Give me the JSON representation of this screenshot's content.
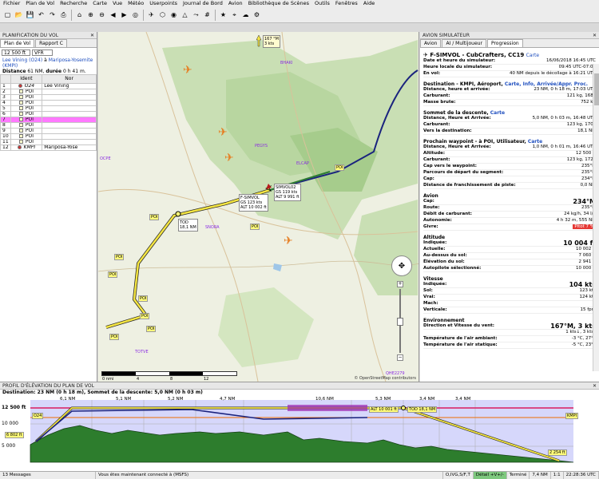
{
  "menu": [
    "Fichier",
    "Plan de Vol",
    "Recherche",
    "Carte",
    "Vue",
    "Météo",
    "Userpoints",
    "Journal de Bord",
    "Avion",
    "Bibliothèque de Scènes",
    "Outils",
    "Fenêtres",
    "Aide"
  ],
  "toolbar_icons": [
    "new-icon",
    "open-icon",
    "save-icon",
    "undo-icon",
    "redo-icon",
    "print-icon",
    "home-icon",
    "zoom-in-icon",
    "zoom-out-icon",
    "back-icon",
    "forward-icon",
    "center-icon",
    "airport-icon",
    "vor-icon",
    "ndb-icon",
    "waypoint-icon",
    "airway-icon",
    "grid-icon",
    "star-icon",
    "target-icon",
    "weather-icon",
    "settings-icon"
  ],
  "left_panel": {
    "title": "PLANIFICATION DU VOL",
    "tabs": [
      "Plan de Vol",
      "Rapport C"
    ],
    "altitude": "12 500 ft",
    "rule": "VFR",
    "route_from": "Lee Vining (O24)",
    "route_mid": " à ",
    "route_to": "Mariposa-Yosemite (KMPI)",
    "distance_label": "Distance",
    "distance_value": "61 NM,",
    "duration_label": "durée",
    "duration_value": "0 h 41 m.",
    "columns": [
      "Ident",
      "Nor"
    ],
    "rows": [
      {
        "n": "1",
        "ident": "O24",
        "name": "Lee Vining",
        "italic": true
      },
      {
        "n": "2",
        "ident": "POI",
        "name": ""
      },
      {
        "n": "3",
        "ident": "POI",
        "name": ""
      },
      {
        "n": "4",
        "ident": "POI",
        "name": ""
      },
      {
        "n": "5",
        "ident": "POI",
        "name": ""
      },
      {
        "n": "6",
        "ident": "POI",
        "name": ""
      },
      {
        "n": "7",
        "ident": "POI",
        "name": "",
        "selected": true
      },
      {
        "n": "8",
        "ident": "POI",
        "name": ""
      },
      {
        "n": "9",
        "ident": "POI",
        "name": ""
      },
      {
        "n": "10",
        "ident": "POI",
        "name": ""
      },
      {
        "n": "11",
        "ident": "POI",
        "name": ""
      },
      {
        "n": "12",
        "ident": "KMPI",
        "name": "Mariposa-Yose",
        "italic": true
      }
    ]
  },
  "map": {
    "labels": {
      "bhaki": "BHAKI",
      "pegys": "PEGYS",
      "elcap": "ELCAP",
      "snora": "SNORA",
      "totve": "TOTVE",
      "ocpe": "OCPE",
      "qhe": "QHE2279"
    },
    "aircraft_callout": [
      "SIMVOL02",
      "GS 119 kts",
      "ALT 9 991 ft"
    ],
    "sim_callout": [
      "F-SIMVOL",
      "GS 123 kts",
      "ALT 10 002 ft"
    ],
    "tod_callout": [
      "TOD",
      "18,1 NM"
    ],
    "wind_callout": [
      "167 °M",
      "3 kts"
    ],
    "scale_labels": [
      "0 nmi",
      "4",
      "8",
      "12"
    ],
    "credit": "© OpenStreetMap contributors",
    "wp_labels": [
      "POI",
      "POI",
      "POI",
      "POI",
      "POI",
      "POI",
      "POI",
      "POI",
      "POI"
    ]
  },
  "right_panel": {
    "title": "AVION SIMULATEUR",
    "tabs": [
      "Avion",
      "AI / Multijoueur",
      "Progression"
    ],
    "aircraft": "F-SIMVOL - CubCrafters, CC19",
    "aircraft_link": "Carte",
    "sim_rows": [
      {
        "k": "Date et heure du simulateur:",
        "v": "16/06/2018 16:45 UTC"
      },
      {
        "k": "Heure locale du simulateur:",
        "v": "09:45 UTC-07:00"
      },
      {
        "k": "En vol:",
        "v": "40 NM depuis le décollage à 16:21 UTC"
      }
    ],
    "dest_title": "Destination - KMPI, Aéroport,",
    "dest_links": "Carte, Info, Arrivée/Appr. Proc.",
    "dest_rows": [
      {
        "k": "Distance, heure et arrivée:",
        "v": "23 NM, 0 h 18 m, 17:03 UTC"
      },
      {
        "k": "Carburant:",
        "v": "121 kg, 168 l"
      },
      {
        "k": "Masse brute:",
        "v": "752 kg"
      }
    ],
    "tod_title": "Sommet de la descente,",
    "tod_link": "Carte",
    "tod_rows": [
      {
        "k": "Distance, Heure et Arrivée:",
        "v": "5,0 NM, 0 h 03 m, 16:48 UTC"
      },
      {
        "k": "Carburant:",
        "v": "123 kg, 170 l"
      },
      {
        "k": "Vers la destination:",
        "v": "18,1 NM"
      }
    ],
    "next_title": "Prochain waypoint - à POI, Utilisateur,",
    "next_link": "Carte",
    "next_rows": [
      {
        "k": "Distance, Heure et Arrivée:",
        "v": "1,0 NM, 0 h 01 m, 16:46 UTC"
      },
      {
        "k": "Altitude:",
        "v": "12 500 ft"
      },
      {
        "k": "Carburant:",
        "v": "123 kg, 172 l"
      },
      {
        "k": "Cap vers le waypoint:",
        "v": "235°M"
      },
      {
        "k": "Parcours de départ du segment:",
        "v": "235°M"
      },
      {
        "k": "Cap:",
        "v": "234°M"
      },
      {
        "k": "Distance de franchissement de piste:",
        "v": "0,0 NM"
      }
    ],
    "avion_title": "Avion",
    "avion_rows": [
      {
        "k": "Cap:",
        "v": "234°M",
        "big": true
      },
      {
        "k": "Route:",
        "v": "235°M"
      },
      {
        "k": "Débit de carburant:",
        "v": "24 kg/h, 34 l/h"
      },
      {
        "k": "Autonomie:",
        "v": "4 h 32 m, 555 NM"
      },
      {
        "k": "Givre:",
        "v": "Pitot 7 %",
        "warn": true
      }
    ],
    "alt_title": "Altitude",
    "alt_rows": [
      {
        "k": "Indiquée:",
        "v": "10 004 ft",
        "big": true
      },
      {
        "k": "Actuelle:",
        "v": "10 002 ft"
      },
      {
        "k": "Au-dessus du sol:",
        "v": "7 060 ft"
      },
      {
        "k": "Élévation du sol:",
        "v": "2 941 ft"
      },
      {
        "k": "Autopilote sélectionné:",
        "v": "10 000 ft"
      }
    ],
    "speed_title": "Vitesse",
    "speed_rows": [
      {
        "k": "Indiquée:",
        "v": "104 kts",
        "big": true
      },
      {
        "k": "Sol:",
        "v": "123 kts"
      },
      {
        "k": "Vrai:",
        "v": "124 kts"
      },
      {
        "k": "Mach:",
        "v": "-"
      },
      {
        "k": "Verticale:",
        "v": "15 fpm"
      }
    ],
    "env_title": "Environnement",
    "env_rows": [
      {
        "k": "Direction et Vitesse du vent:",
        "v": "167°M, 3 kts",
        "big": true
      },
      {
        "k": "",
        "v": "1 kts↓, 3 kts▸"
      },
      {
        "k": "Température de l'air ambiant:",
        "v": "-3 °C, 27°F"
      },
      {
        "k": "Température de l'air statique:",
        "v": "-5 °C, 23°F"
      }
    ]
  },
  "profile": {
    "title": "PROFIL D'ÉLÉVATION DU PLAN DE VOL",
    "subtitle": "Destination: 23 NM (0 h 18 m),  Sommet de la descente: 5,0 NM (0 h 03 m)",
    "axis_labels": [
      "12 500 ft",
      "10 000",
      "5 000"
    ],
    "dist_labels": [
      "6,1 NM",
      "5,1 NM",
      "5,2 NM",
      "4,7 NM",
      "10,6 NM",
      "5,3 NM",
      "3,4 NM",
      "3,4 NM"
    ],
    "tags": [
      "O24",
      "ALT 10 001 ft",
      "TOD 18,1 NM",
      "KMPI",
      "2 254 ft",
      "6 802 ft"
    ]
  },
  "status": {
    "messages": "13 Messages",
    "connection": "Vous êtes maintenant connecté à (MSFS)",
    "mode": "O,IVG,S/F,T",
    "detail": "Détail +V+/-",
    "done": "Terminé",
    "dist": "7,4 NM",
    "zoom": "1:1",
    "time": "22:28:36 UTC"
  }
}
